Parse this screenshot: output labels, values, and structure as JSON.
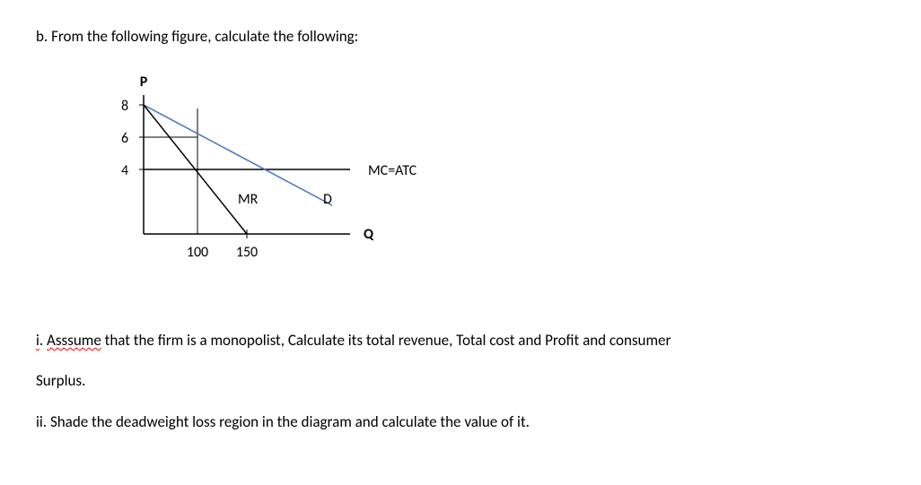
{
  "question": {
    "intro": "b. From the following figure, calculate the following:",
    "sub_i_prefix": "i",
    "sub_i_word": "Asssume",
    "sub_i_rest1": " that the firm is a monopolist, Calculate its total revenue, Total cost and Profit and consumer",
    "sub_i_rest2": "Surplus.",
    "sub_ii": "ii. Shade the deadweight loss region in the diagram and calculate the value of it."
  },
  "chart_data": {
    "type": "line",
    "title": "",
    "xlabel": "Q",
    "ylabel": "P",
    "y_ticks": [
      4,
      6,
      8
    ],
    "x_ticks": [
      100,
      150
    ],
    "curves": {
      "demand": {
        "label": "D",
        "points": [
          [
            0,
            8
          ],
          [
            200,
            2.667
          ]
        ]
      },
      "marginal_revenue": {
        "label": "MR",
        "points": [
          [
            0,
            8
          ],
          [
            150,
            0
          ]
        ]
      },
      "mc_atc": {
        "label": "MC=ATC",
        "y": 4
      }
    },
    "ylim": [
      0,
      9
    ],
    "xlim": [
      0,
      250
    ],
    "monopoly": {
      "quantity": 100,
      "price": 6,
      "mc": 4
    }
  }
}
